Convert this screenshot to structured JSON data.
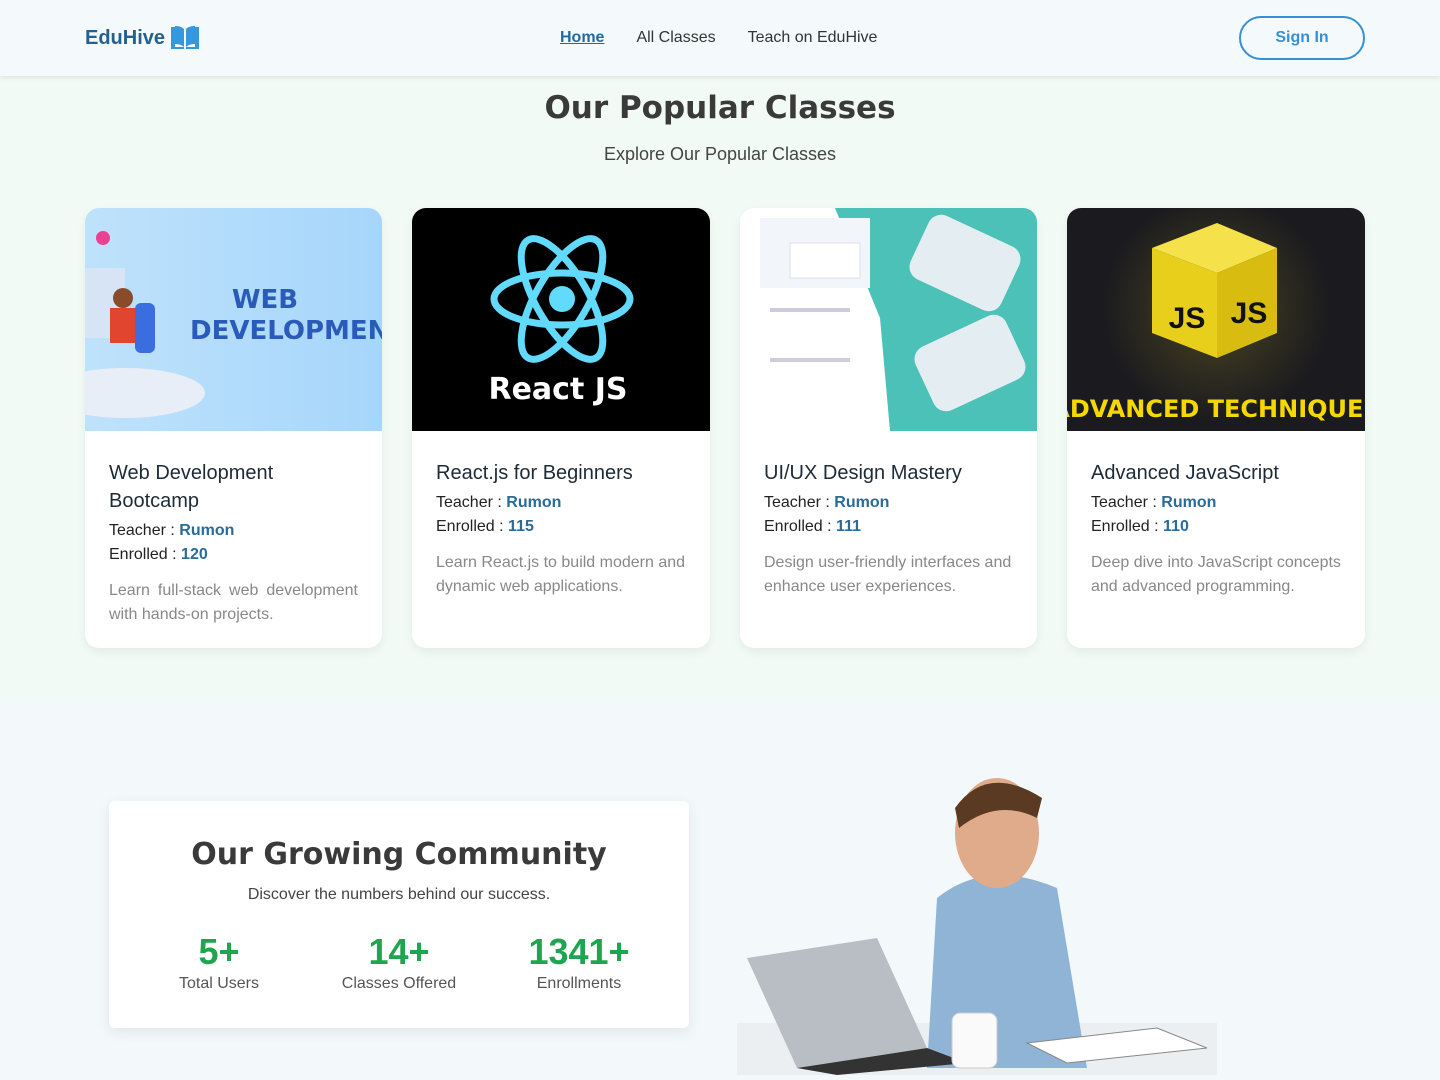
{
  "header": {
    "logo": "EduHive",
    "nav": [
      "Home",
      "All Classes",
      "Teach on EduHive"
    ],
    "sign_in": "Sign In"
  },
  "popular": {
    "title": "Our Popular Classes",
    "subtitle": "Explore Our Popular Classes",
    "teacher_label": "Teacher : ",
    "enrolled_label": "Enrolled : ",
    "classes": [
      {
        "title": "Web Development Bootcamp",
        "teacher": "Rumon",
        "enrolled": "120",
        "description": "Learn full-stack web development with hands-on projects.",
        "image_text": "WEB DEVELOPMENT"
      },
      {
        "title": "React.js for Beginners",
        "teacher": "Rumon",
        "enrolled": "115",
        "description": "Learn React.js to build modern and dynamic web applications.",
        "image_text": "React JS"
      },
      {
        "title": "UI/UX Design Mastery",
        "teacher": "Rumon",
        "enrolled": "111",
        "description": "Design user-friendly interfaces and enhance user experiences."
      },
      {
        "title": "Advanced JavaScript",
        "teacher": "Rumon",
        "enrolled": "110",
        "description": "Deep dive into JavaScript concepts and advanced programming.",
        "image_text": "ADVANCED TECHNIQUES"
      }
    ]
  },
  "community": {
    "title": "Our Growing Community",
    "subtitle": "Discover the numbers behind our success.",
    "stats": [
      {
        "value": "5+",
        "label": "Total Users"
      },
      {
        "value": "14+",
        "label": "Classes Offered"
      },
      {
        "value": "1341+",
        "label": "Enrollments"
      }
    ]
  },
  "colors": {
    "brand": "#24618f",
    "accent": "#3590d6",
    "stat": "#1fa54f"
  }
}
